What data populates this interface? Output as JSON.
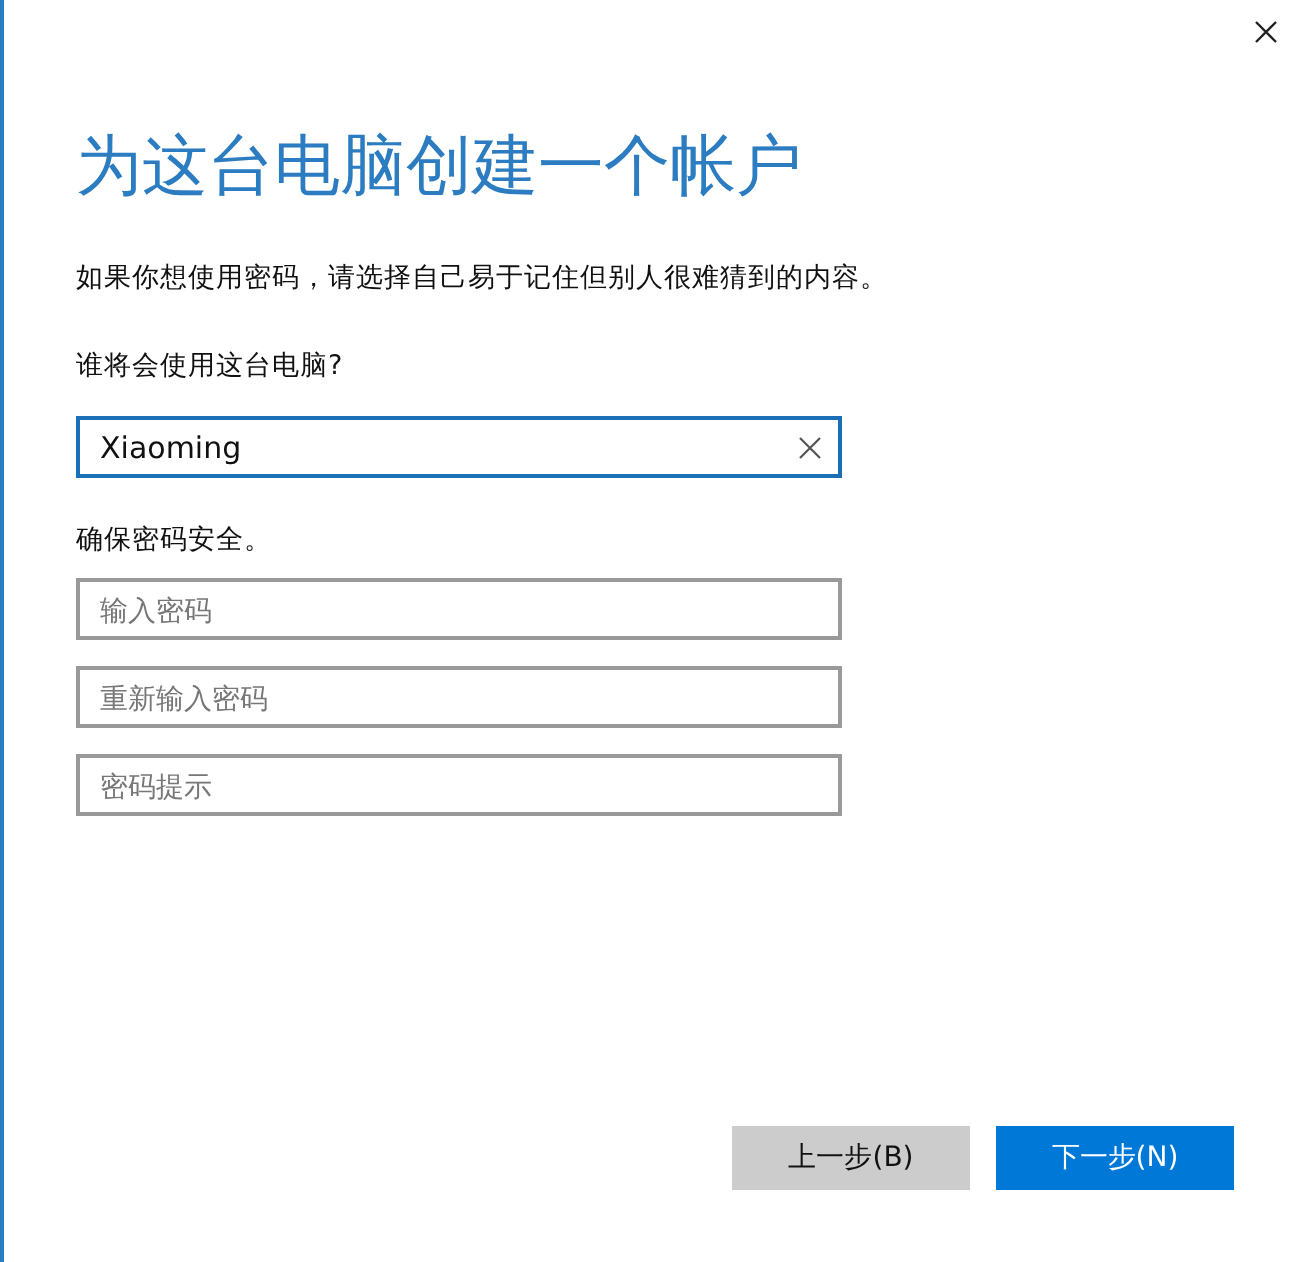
{
  "title": "为这台电脑创建一个帐户",
  "description": "如果你想使用密码，请选择自己易于记住但别人很难猜到的内容。",
  "name_label": "谁将会使用这台电脑?",
  "name_field": {
    "value": "Xiaoming"
  },
  "password_label": "确保密码安全。",
  "password_fields": [
    {
      "placeholder": "输入密码"
    },
    {
      "placeholder": "重新输入密码"
    },
    {
      "placeholder": "密码提示"
    }
  ],
  "buttons": [
    {
      "label": "上一步(B)",
      "kind": "secondary"
    },
    {
      "label": "下一步(N)",
      "kind": "primary"
    }
  ]
}
